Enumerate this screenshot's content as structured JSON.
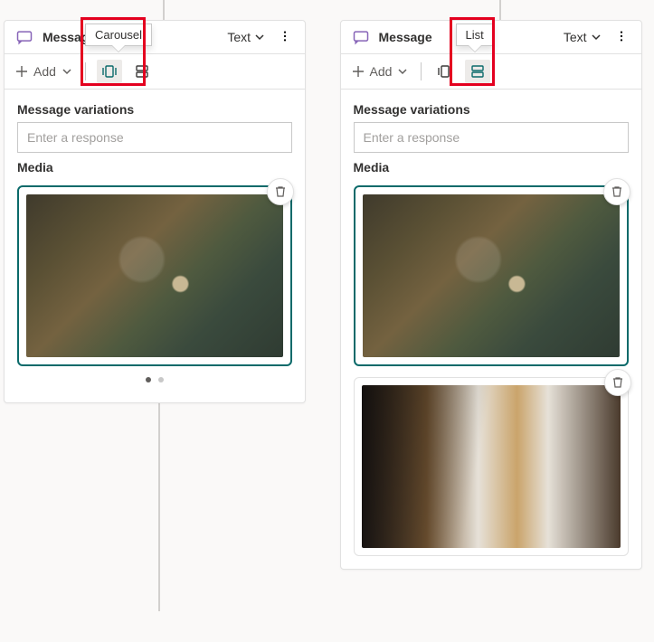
{
  "left": {
    "title": "Message",
    "tooltip": "Carousel",
    "text_dropdown": "Text",
    "add_label": "Add",
    "section_variations": "Message variations",
    "response_placeholder": "Enter a response",
    "section_media": "Media",
    "pager": {
      "count": 2,
      "active": 0
    }
  },
  "right": {
    "title": "Message",
    "tooltip": "List",
    "text_dropdown": "Text",
    "add_label": "Add",
    "section_variations": "Message variations",
    "response_placeholder": "Enter a response",
    "section_media": "Media"
  }
}
